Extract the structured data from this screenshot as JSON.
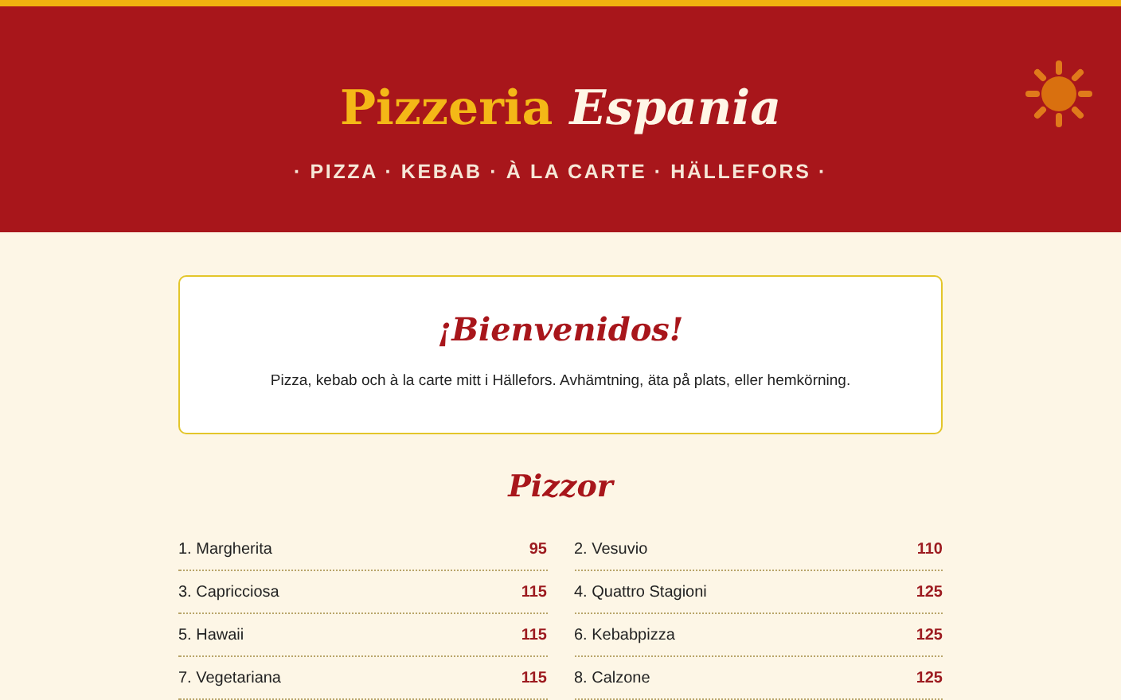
{
  "header": {
    "title_first": "Pizzeria",
    "title_second": "Espania",
    "tagline": "· PIZZA · KEBAB · À LA CARTE · HÄLLEFORS ·"
  },
  "welcome": {
    "heading": "¡Bienvenidos!",
    "text": "Pizza, kebab och à la carte mitt i Hällefors. Avhämtning, äta på plats, eller hemkörning."
  },
  "menu": {
    "heading": "Pizzor",
    "items": [
      {
        "name": "1. Margherita",
        "price": "95"
      },
      {
        "name": "2. Vesuvio",
        "price": "110"
      },
      {
        "name": "3. Capricciosa",
        "price": "115"
      },
      {
        "name": "4. Quattro Stagioni",
        "price": "125"
      },
      {
        "name": "5. Hawaii",
        "price": "115"
      },
      {
        "name": "6. Kebabpizza",
        "price": "125"
      },
      {
        "name": "7. Vegetariana",
        "price": "115"
      },
      {
        "name": "8. Calzone",
        "price": "125"
      }
    ]
  }
}
